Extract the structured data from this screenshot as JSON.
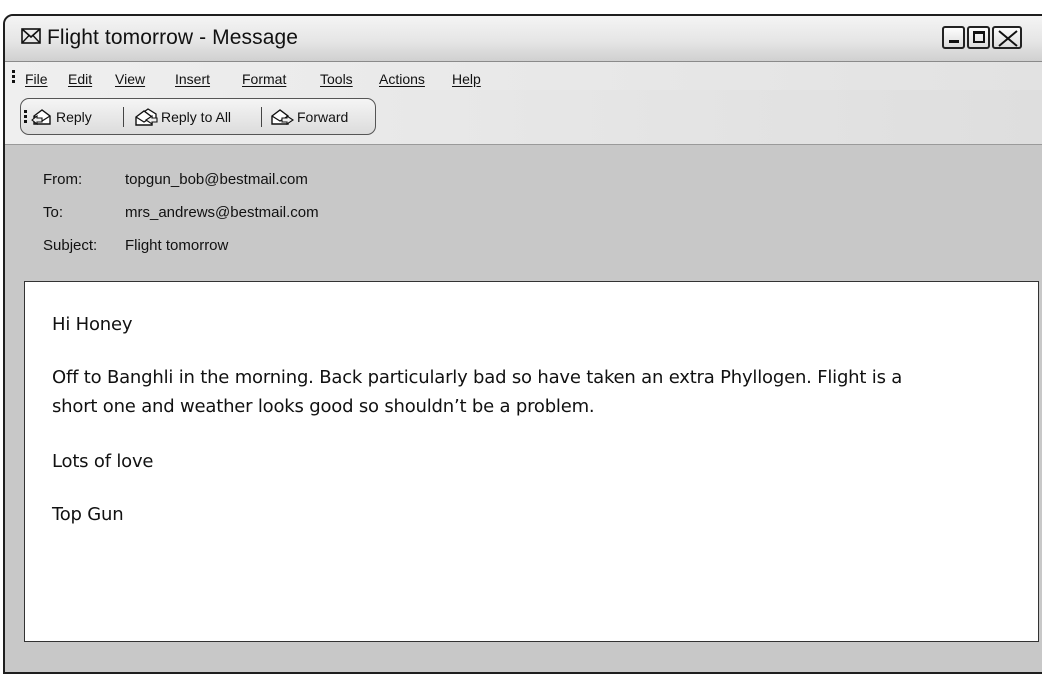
{
  "window": {
    "title": "Flight tomorrow - Message"
  },
  "menu": [
    {
      "label": "File",
      "name": "menu-file"
    },
    {
      "label": "Edit",
      "name": "menu-edit"
    },
    {
      "label": "View",
      "name": "menu-view"
    },
    {
      "label": "Insert",
      "name": "menu-insert"
    },
    {
      "label": "Format",
      "name": "menu-format"
    },
    {
      "label": "Tools",
      "name": "menu-tools"
    },
    {
      "label": "Actions",
      "name": "menu-actions"
    },
    {
      "label": "Help",
      "name": "menu-help"
    }
  ],
  "toolbar": {
    "reply_label": "Reply",
    "reply_all_label": "Reply to All",
    "forward_label": "Forward"
  },
  "headers": {
    "from_label": "From:",
    "from_value": "topgun_bob@bestmail.com",
    "to_label": "To:",
    "to_value": "mrs_andrews@bestmail.com",
    "subject_label": "Subject:",
    "subject_value": "Flight tomorrow"
  },
  "message": {
    "greeting": "Hi Honey",
    "line1": "Off to Banghli in the morning. Back particularly bad so have taken an extra Phyllogen.  Flight is a",
    "line2": "short one and weather looks good so shouldn’t be a problem.",
    "closing": "Lots of love",
    "signature": "Top Gun"
  },
  "icons": {
    "title": "envelope-icon",
    "reply": "reply-icon",
    "reply_all": "reply-all-icon",
    "forward": "forward-icon"
  }
}
